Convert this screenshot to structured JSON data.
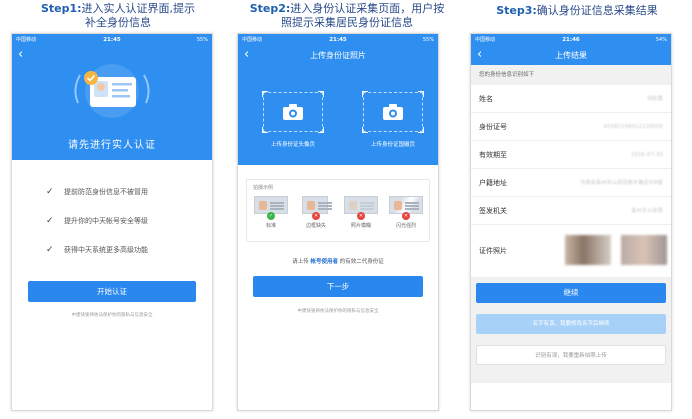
{
  "steps": [
    {
      "label": "Step1:",
      "line1": "进入实人认证界面,提示",
      "line2": "补全身份信息"
    },
    {
      "label": "Step2:",
      "line1": "进入身份认证采集页面，用户按",
      "line2": "照提示采集居民身份证信息"
    },
    {
      "label": "Step3:",
      "line1": "确认身份证信息采集结果",
      "line2": ""
    }
  ],
  "status": {
    "carrier": "中国移动",
    "battery1": "55%",
    "battery2": "55%",
    "battery3": "54%",
    "time1": "21:45",
    "time2": "21:45",
    "time3": "21:46"
  },
  "screen1": {
    "title": "请先进行实人认证",
    "benefits": [
      "提前防范身份信息不被冒用",
      "提升你的中天帐号安全等级",
      "获得中天系统更多高级功能"
    ],
    "start_button": "开始认证",
    "fine_print": "中建快速将依法保护你的隐私与信息安全"
  },
  "screen2": {
    "nav_title": "上传身份证照片",
    "front_label": "上传身份证头像页",
    "back_label": "上传身份证国徽页",
    "examples_title": "拍摄示例",
    "examples": [
      "标准",
      "边框缺失",
      "照片模糊",
      "闪光强烈"
    ],
    "hint_prefix": "请上传",
    "hint_user": "帐号使用者",
    "hint_suffix": "的有效二代身份证",
    "next_button": "下一步",
    "fine_print": "中建快速将依法保护你的隐私与信息安全"
  },
  "screen3": {
    "nav_title": "上传结果",
    "subheading": "您的身份信息识别如下",
    "fields": [
      {
        "key": "姓名",
        "value": "刘彩霞"
      },
      {
        "key": "身份证号",
        "value": "41082199012120000"
      },
      {
        "key": "有效期至",
        "value": "2016-07-30"
      },
      {
        "key": "户籍地址",
        "value": "河南省禹州市山货回族乡路庄村8组"
      },
      {
        "key": "签发机关",
        "value": "禹州市公安局"
      }
    ],
    "photo_label": "证件照片",
    "confirm_button": "继续",
    "edit_button": "名字有误，我要修改名字后继续",
    "retake_button": "识别有误，我要重新拍照上传"
  },
  "colors": {
    "primary": "#2f8ff0",
    "button": "#2a87ee",
    "caption": "#1f5fb0"
  }
}
